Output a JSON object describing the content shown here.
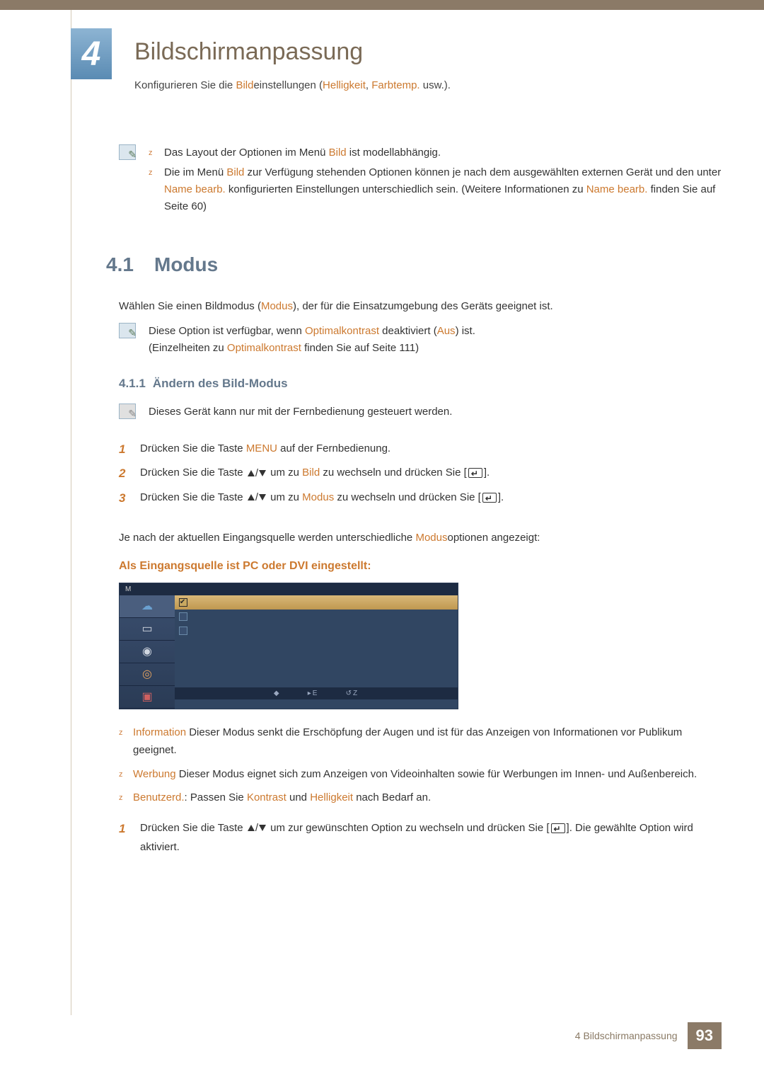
{
  "chapter": {
    "number": "4",
    "title": "Bildschirmanpassung",
    "sub_pre": "Konfigurieren Sie die ",
    "sub_hl1": "Bild",
    "sub_mid1": "einstellungen (",
    "sub_hl2": "Helligkeit",
    "sub_mid2": ", ",
    "sub_hl3": "Farbtemp.",
    "sub_end": " usw.)."
  },
  "intro_note": {
    "b1_pre": "Das Layout der Optionen im Menü ",
    "b1_hl": "Bild",
    "b1_post": " ist modellabhängig.",
    "b2_pre": "Die im Menü ",
    "b2_hl1": "Bild",
    "b2_mid1": " zur Verfügung stehenden Optionen können je nach dem ausgewählten externen Gerät und den unter ",
    "b2_hl2": "Name bearb.",
    "b2_mid2": " konfigurierten Einstellungen unterschiedlich sein. (Weitere Informationen zu ",
    "b2_hl3": "Name bearb.",
    "b2_post": " finden Sie auf Seite 60)"
  },
  "sec41": {
    "num": "4.1",
    "title": "Modus",
    "intro_pre": "Wählen Sie einen Bildmodus (",
    "intro_hl": "Modus",
    "intro_post": "), der für die Einsatzumgebung des Geräts geeignet ist.",
    "note_l1_pre": "Diese Option ist verfügbar, wenn ",
    "note_l1_hl1": "Optimalkontrast",
    "note_l1_mid": " deaktiviert (",
    "note_l1_hl2": "Aus",
    "note_l1_post": ") ist.",
    "note_l2_pre": "(Einzelheiten zu ",
    "note_l2_hl": "Optimalkontrast",
    "note_l2_post": " finden Sie auf Seite 111)"
  },
  "sec411": {
    "num": "4.1.1",
    "title": "Ändern des Bild-Modus",
    "remote_note": "Dieses Gerät kann nur mit der Fernbedienung gesteuert werden.",
    "step1_pre": "Drücken Sie die Taste ",
    "step1_hl": "MENU",
    "step1_post": " auf der Fernbedienung.",
    "step2_pre": "Drücken Sie die Taste ",
    "step2_mid": " um zu ",
    "step2_hl": "Bild",
    "step2_post": " zu wechseln und drücken Sie [",
    "step2_end": "].",
    "step3_pre": "Drücken Sie die Taste ",
    "step3_mid": " um zu ",
    "step3_hl": "Modus",
    "step3_post": " zu wechseln und drücken Sie [",
    "step3_end": "].",
    "after_pre": "Je nach der aktuellen Eingangsquelle werden unterschiedliche ",
    "after_hl": "Modus",
    "after_post": "optionen angezeigt:"
  },
  "pc_dvi": {
    "heading": "Als Eingangsquelle ist PC oder DVI eingestellt:",
    "menu_caption": "M",
    "menu_items": [
      "",
      "",
      ""
    ],
    "menu_footer_enter": "E",
    "menu_footer_z": "Z",
    "desc": [
      {
        "label": "Information",
        "text": " Dieser Modus senkt die Erschöpfung der Augen und ist für das Anzeigen von Informationen vor Publikum geeignet."
      },
      {
        "label": "Werbung",
        "text": " Dieser Modus eignet sich zum Anzeigen von Videoinhalten sowie für Werbungen im Innen- und Außenbereich."
      },
      {
        "label": "Benutzerd.",
        "mid1": ": Passen Sie ",
        "hl1": "Kontrast",
        "mid2": " und ",
        "hl2": "Helligkeit",
        "post": " nach Bedarf an."
      }
    ],
    "final_step_pre": "Drücken Sie die Taste ",
    "final_step_mid": " um zur gewünschten Option zu wechseln und drücken Sie [",
    "final_step_end": "]. Die gewählte Option wird aktiviert."
  },
  "footer": {
    "text": "4 Bildschirmanpassung",
    "page": "93"
  }
}
